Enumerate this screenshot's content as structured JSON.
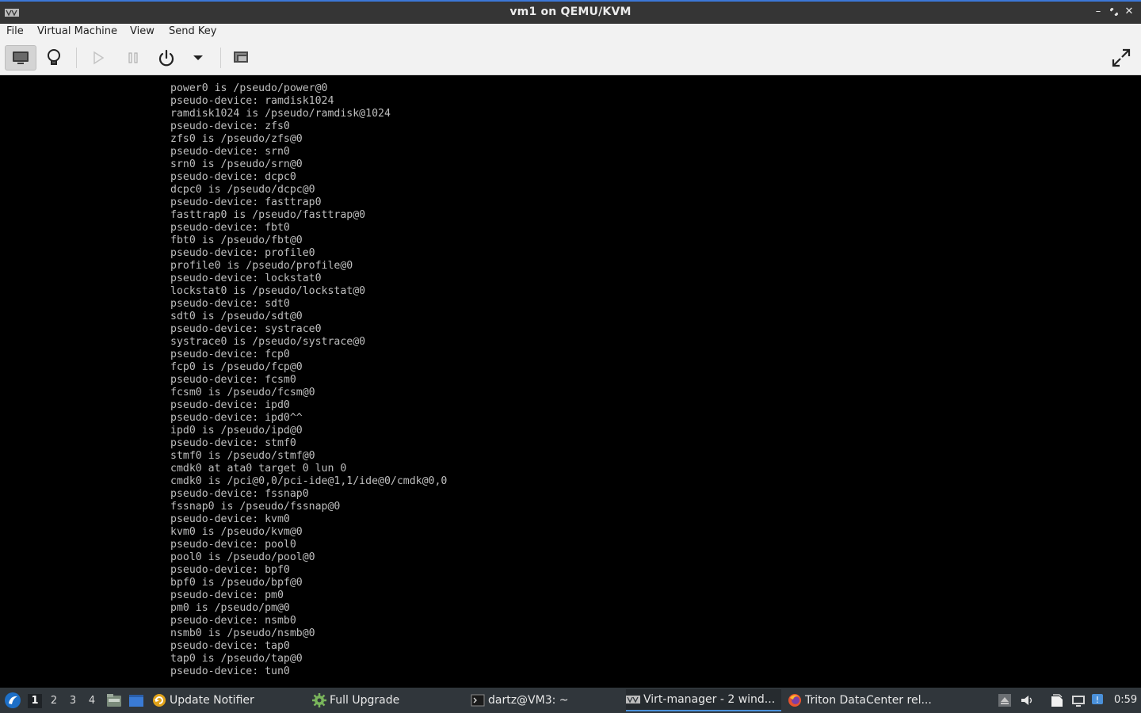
{
  "window": {
    "title": "vm1 on QEMU/KVM"
  },
  "menu": {
    "file": "File",
    "virtual_machine": "Virtual Machine",
    "view": "View",
    "send_key": "Send Key"
  },
  "toolbar": {
    "icons": [
      "console-icon",
      "lightbulb-icon",
      "play-icon",
      "pause-icon",
      "power-icon",
      "dropdown-arrow-icon",
      "snapshots-icon",
      "fullscreen-icon"
    ]
  },
  "console": {
    "lines": [
      "power0 is /pseudo/power@0",
      "pseudo-device: ramdisk1024",
      "ramdisk1024 is /pseudo/ramdisk@1024",
      "pseudo-device: zfs0",
      "zfs0 is /pseudo/zfs@0",
      "pseudo-device: srn0",
      "srn0 is /pseudo/srn@0",
      "pseudo-device: dcpc0",
      "dcpc0 is /pseudo/dcpc@0",
      "pseudo-device: fasttrap0",
      "fasttrap0 is /pseudo/fasttrap@0",
      "pseudo-device: fbt0",
      "fbt0 is /pseudo/fbt@0",
      "pseudo-device: profile0",
      "profile0 is /pseudo/profile@0",
      "pseudo-device: lockstat0",
      "lockstat0 is /pseudo/lockstat@0",
      "pseudo-device: sdt0",
      "sdt0 is /pseudo/sdt@0",
      "pseudo-device: systrace0",
      "systrace0 is /pseudo/systrace@0",
      "pseudo-device: fcp0",
      "fcp0 is /pseudo/fcp@0",
      "pseudo-device: fcsm0",
      "fcsm0 is /pseudo/fcsm@0",
      "pseudo-device: ipd0",
      "pseudo-device: ipd0^^",
      "ipd0 is /pseudo/ipd@0",
      "pseudo-device: stmf0",
      "stmf0 is /pseudo/stmf@0",
      "cmdk0 at ata0 target 0 lun 0",
      "cmdk0 is /pci@0,0/pci-ide@1,1/ide@0/cmdk@0,0",
      "pseudo-device: fssnap0",
      "fssnap0 is /pseudo/fssnap@0",
      "pseudo-device: kvm0",
      "kvm0 is /pseudo/kvm@0",
      "pseudo-device: pool0",
      "pool0 is /pseudo/pool@0",
      "pseudo-device: bpf0",
      "bpf0 is /pseudo/bpf@0",
      "pseudo-device: pm0",
      "pm0 is /pseudo/pm@0",
      "pseudo-device: nsmb0",
      "nsmb0 is /pseudo/nsmb@0",
      "pseudo-device: tap0",
      "tap0 is /pseudo/tap@0",
      "pseudo-device: tun0"
    ]
  },
  "taskbar": {
    "workspaces": [
      "1",
      "2",
      "3",
      "4"
    ],
    "tasks": {
      "update_notifier": "Update Notifier",
      "full_upgrade": "Full Upgrade",
      "terminal": "dartz@VM3: ~",
      "virt_manager": "Virt-manager - 2 wind...",
      "firefox": "Triton DataCenter rel..."
    },
    "clock": "0:59"
  },
  "colors": {
    "titlebar_bg": "#353535",
    "accent": "#3c78d8",
    "console_bg": "#000000",
    "console_text": "#bfbfbf",
    "taskbar_bg": "#30363b"
  }
}
